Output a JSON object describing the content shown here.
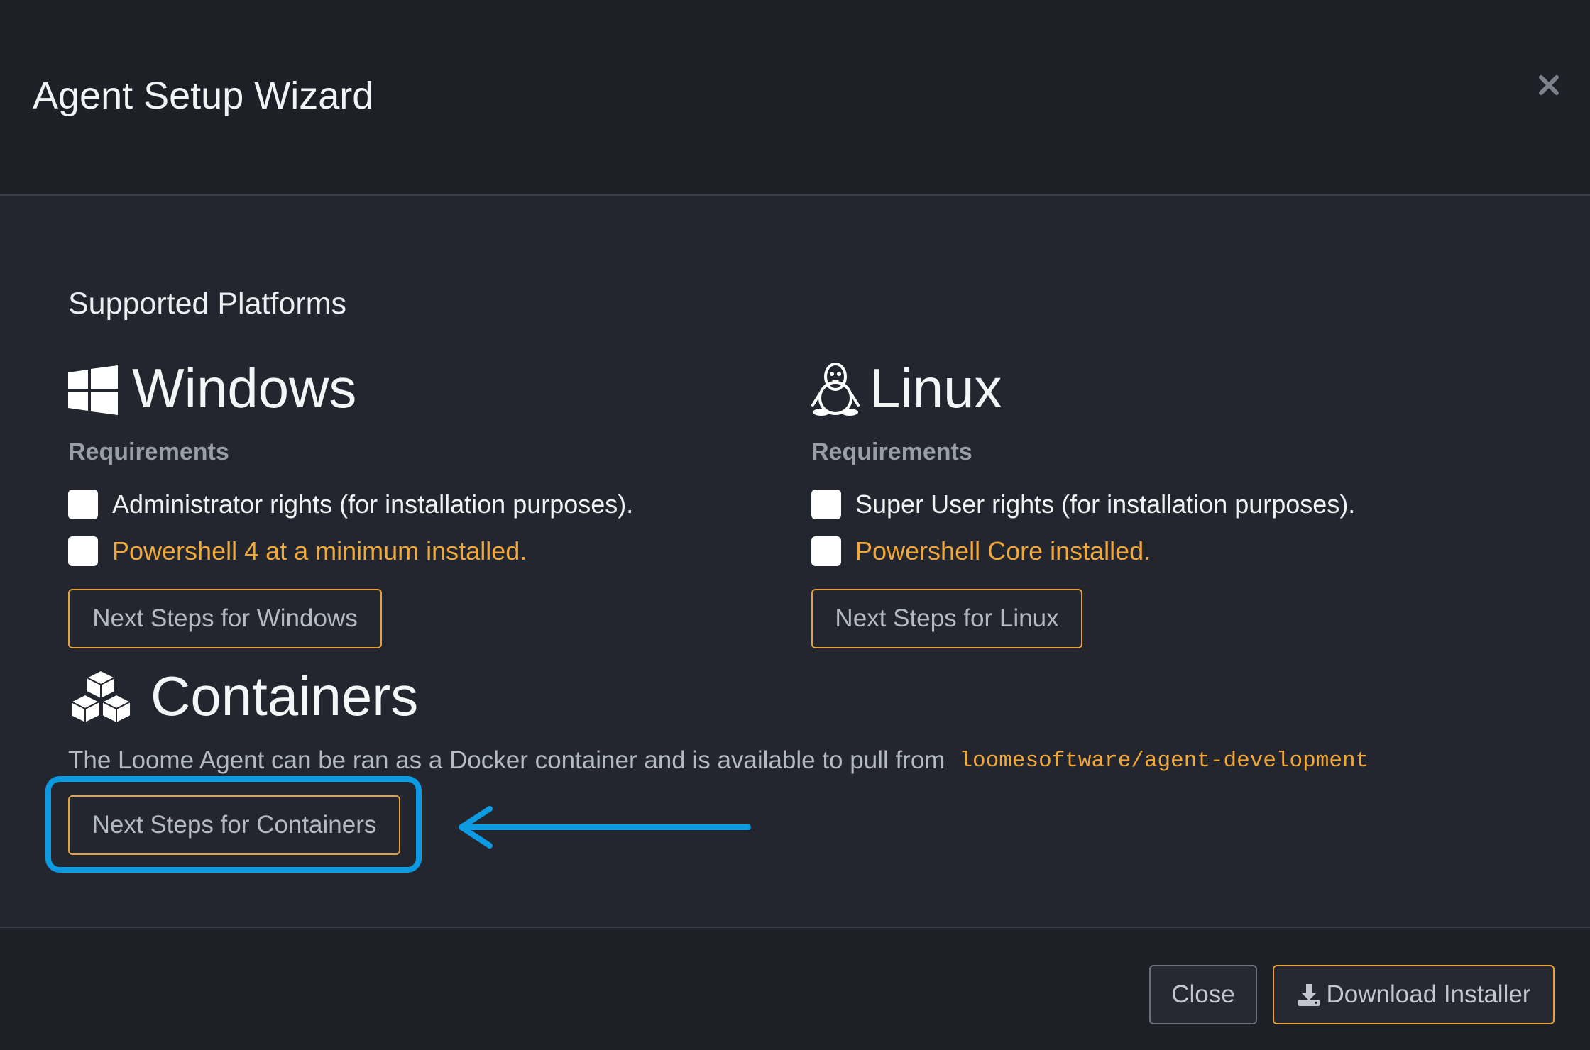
{
  "modal": {
    "title": "Agent Setup Wizard",
    "close_icon": "close-icon"
  },
  "body": {
    "section_title": "Supported Platforms",
    "windows": {
      "icon": "windows-icon",
      "title": "Windows",
      "requirements_label": "Requirements",
      "requirements": [
        {
          "text": "Administrator rights (for installation purposes).",
          "checked": false,
          "color": "#f1f2f4"
        },
        {
          "text": "Powershell 4 at a minimum installed.",
          "checked": false,
          "color": "#f0a83a"
        }
      ],
      "button_label": "Next Steps for Windows"
    },
    "linux": {
      "icon": "linux-penguin-icon",
      "title": "Linux",
      "requirements_label": "Requirements",
      "requirements": [
        {
          "text": "Super User rights (for installation purposes).",
          "checked": false,
          "color": "#f1f2f4"
        },
        {
          "text": "Powershell Core installed.",
          "checked": false,
          "color": "#f0a83a"
        }
      ],
      "button_label": "Next Steps for Linux"
    },
    "containers": {
      "icon": "cubes-icon",
      "title": "Containers",
      "description": "The Loome Agent can be ran as a Docker container and is available to pull from",
      "repository": "loomesoftware/agent-development",
      "button_label": "Next Steps for Containers"
    }
  },
  "annotation": {
    "highlight_color": "#0c9ae2",
    "arrow_icon": "left-arrow-icon"
  },
  "footer": {
    "close_label": "Close",
    "download_label": "Download Installer",
    "download_icon": "download-icon"
  },
  "colors": {
    "accent": "#e5a23c",
    "warning_text": "#f0a83a",
    "background": "#23262e",
    "header_background": "#1e2027"
  }
}
